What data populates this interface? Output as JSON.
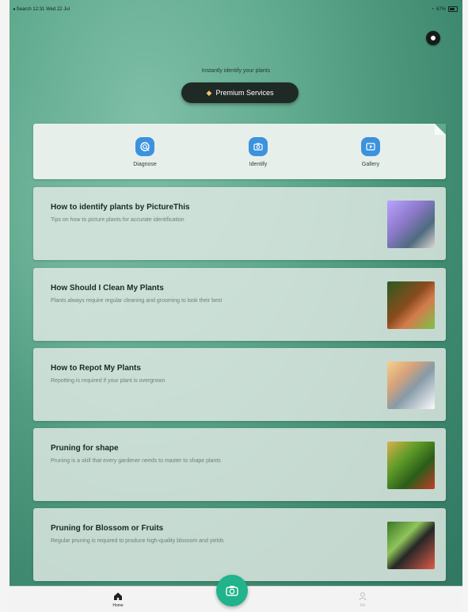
{
  "status": {
    "back_label": "◂ Search",
    "time": "12:31",
    "date": "Wed 22 Jul",
    "battery": "67%"
  },
  "header": {
    "tagline": "Instantly identify your plants",
    "premium_label": "Premium Services"
  },
  "tools": [
    {
      "label": "Diagnose",
      "icon": "diagnose-icon"
    },
    {
      "label": "Identify",
      "icon": "camera-icon"
    },
    {
      "label": "Gallery",
      "icon": "gallery-icon"
    }
  ],
  "articles": [
    {
      "title": "How to identify plants by PictureThis",
      "desc": "Tips on how to picture plants for accurate identification"
    },
    {
      "title": "How Should I Clean My Plants",
      "desc": "Plants always require regular cleaning and grooming to look their best"
    },
    {
      "title": "How to Repot My Plants",
      "desc": "Repotting is required if your plant is overgrown"
    },
    {
      "title": "Pruning for shape",
      "desc": "Pruning is a skill that every gardener needs to master to shape plants"
    },
    {
      "title": "Pruning for Blossom or Fruits",
      "desc": "Regular pruning is required to produce high-quality blossom and yields"
    }
  ],
  "tabbar": {
    "home_label": "Home",
    "me_label": "Me"
  },
  "colors": {
    "accent": "#21b38b",
    "tool_icon": "#3b92de",
    "premium_bg": "#1f2a27"
  }
}
